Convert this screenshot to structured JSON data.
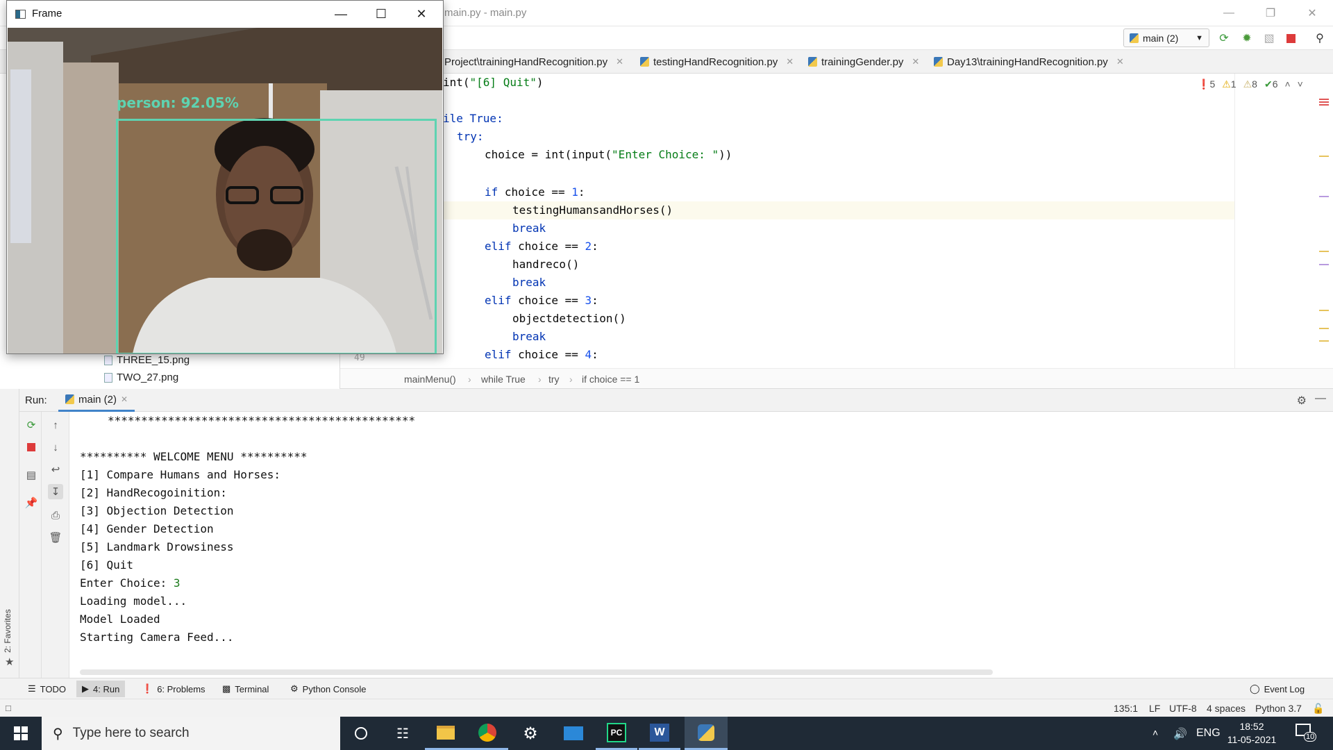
{
  "ide": {
    "title": "main.py - main.py",
    "run_config": "main (2)",
    "tabs": [
      {
        "label": "Project\\trainingHandRecognition.py"
      },
      {
        "label": "testingHandRecognition.py"
      },
      {
        "label": "trainingGender.py"
      },
      {
        "label": "Day13\\trainingHandRecognition.py"
      }
    ],
    "inspections": {
      "errors": "5",
      "warnings": "1",
      "weak_warnings": "8",
      "typos": "6"
    },
    "breadcrumb": [
      "mainMenu()",
      "while True",
      "try",
      "if choice == 1"
    ],
    "gutter_number": "49"
  },
  "code": {
    "l1_a": "int(",
    "l1_b": "\"[6] Quit\"",
    "l1_c": ")",
    "l2_a": "ile True:",
    "l3_a": "try:",
    "l4_a": "choice = ",
    "l4_b": "int",
    "l4_c": "(input(",
    "l4_d": "\"Enter Choice: \"",
    "l4_e": "))",
    "l5_a": "if",
    "l5_b": " choice == ",
    "l5_c": "1",
    "l5_d": ":",
    "l6_a": "testingHumansandHorses()",
    "l7_a": "break",
    "l8_a": "elif",
    "l8_b": " choice == ",
    "l8_c": "2",
    "l8_d": ":",
    "l9_a": "handreco()",
    "l10_a": "break",
    "l11_a": "elif",
    "l11_b": " choice == ",
    "l11_c": "3",
    "l11_d": ":",
    "l12_a": "objectdetection()",
    "l13_a": "break",
    "l14_a": "elif",
    "l14_b": " choice == ",
    "l14_c": "4",
    "l14_d": ":"
  },
  "project_tree": [
    {
      "label": "THREE_15.png"
    },
    {
      "label": "TWO_27.png"
    }
  ],
  "run_panel": {
    "title": "Run:",
    "tab_label": "main (2)",
    "console": [
      "**********************************************",
      "",
      "********** WELCOME MENU **********",
      "[1] Compare Humans and Horses:",
      "[2] HandRecogoinition:",
      "[3] Objection Detection",
      "[4] Gender Detection",
      "[5] Landmark Drowsiness",
      "[6] Quit"
    ],
    "prompt": "Enter Choice: ",
    "prompt_value": "3",
    "after": [
      "Loading model...",
      "Model Loaded",
      "Starting Camera Feed..."
    ]
  },
  "favorites_label": "2: Favorites",
  "tool_windows": {
    "todo": "TODO",
    "run": "4: Run",
    "problems": "6: Problems",
    "terminal": "Terminal",
    "python_console": "Python Console",
    "event_log": "Event Log"
  },
  "status": {
    "position": "135:1",
    "line_sep": "LF",
    "encoding": "UTF-8",
    "indent": "4 spaces",
    "interpreter": "Python 3.7"
  },
  "frame": {
    "title": "Frame",
    "detection_label": "person: 92.05%",
    "detection_color": "#5ed3b1"
  },
  "taskbar": {
    "search_placeholder": "Type here to search",
    "language": "ENG",
    "time": "18:52",
    "date": "11-05-2021",
    "notifications": "10"
  }
}
